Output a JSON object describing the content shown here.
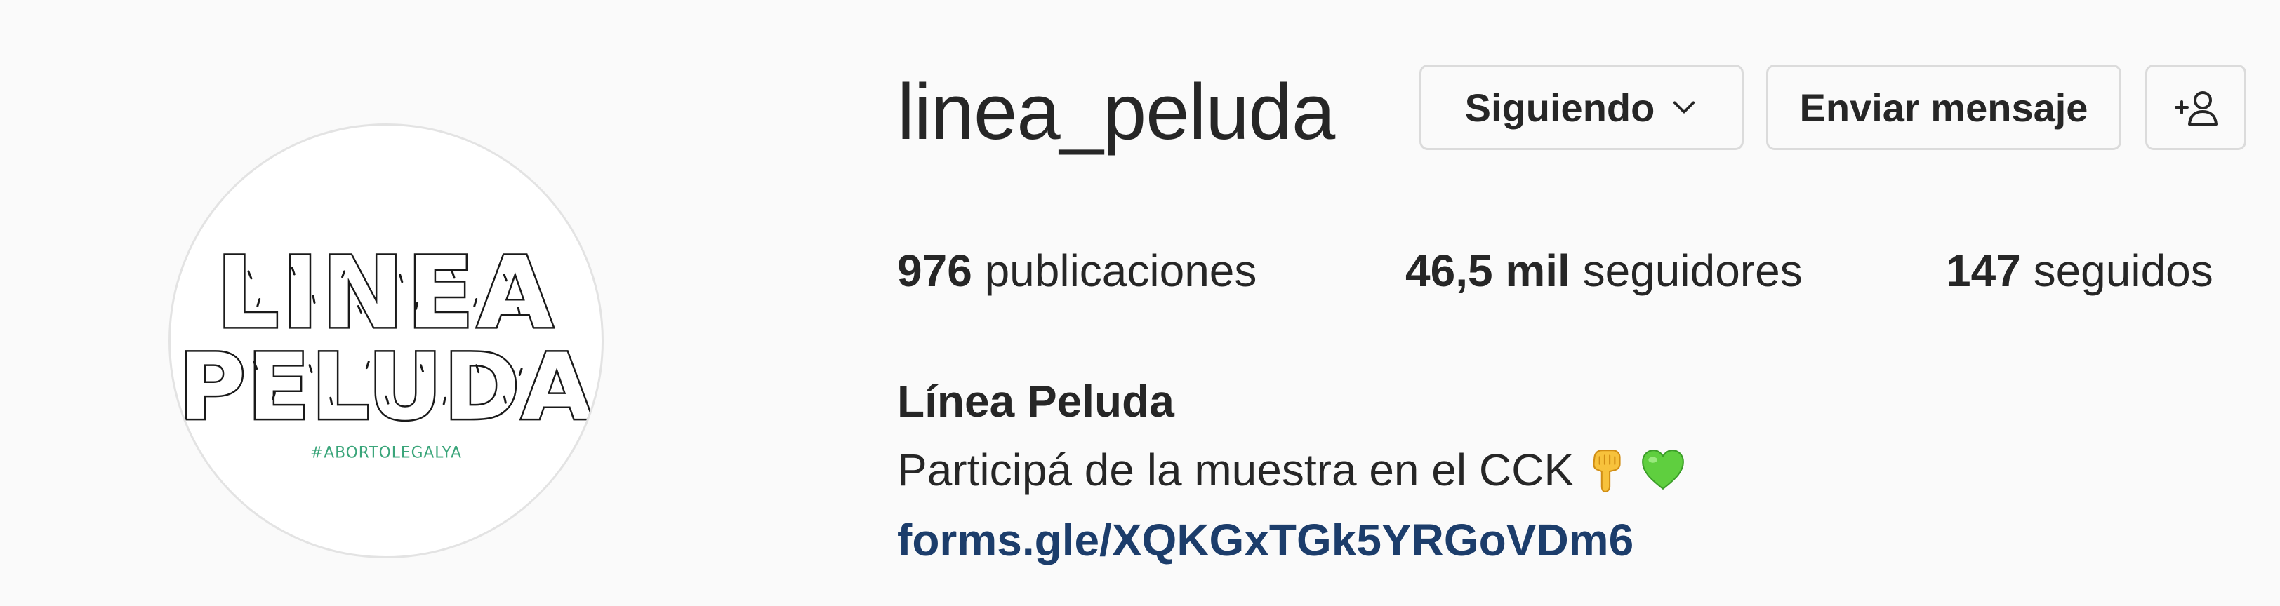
{
  "profile": {
    "username": "linea_peluda",
    "avatar_logo": {
      "line1": "LINEA",
      "line2": "PELUDA",
      "hashtag": "#ABORTOLEGALYA"
    }
  },
  "actions": {
    "following_label": "Siguiendo",
    "message_label": "Enviar mensaje",
    "suggest_icon": "add-person-icon"
  },
  "stats": {
    "posts_count": "976",
    "posts_label": " publicaciones",
    "followers_count": "46,5 mil",
    "followers_label": " seguidores",
    "following_count": "147",
    "following_label": " seguidos"
  },
  "bio": {
    "full_name": "Línea Peluda",
    "text": "Participá de la muestra en el CCK",
    "emojis": [
      "pointing-down-hand-icon",
      "green-heart-icon"
    ],
    "link": "forms.gle/XQKGxTGk5YRGoVDm6"
  },
  "colors": {
    "background": "#fafafa",
    "text": "#262626",
    "link": "#1c3d6b",
    "border": "#dbdbdb",
    "hashtag_green": "#3aa57a"
  }
}
